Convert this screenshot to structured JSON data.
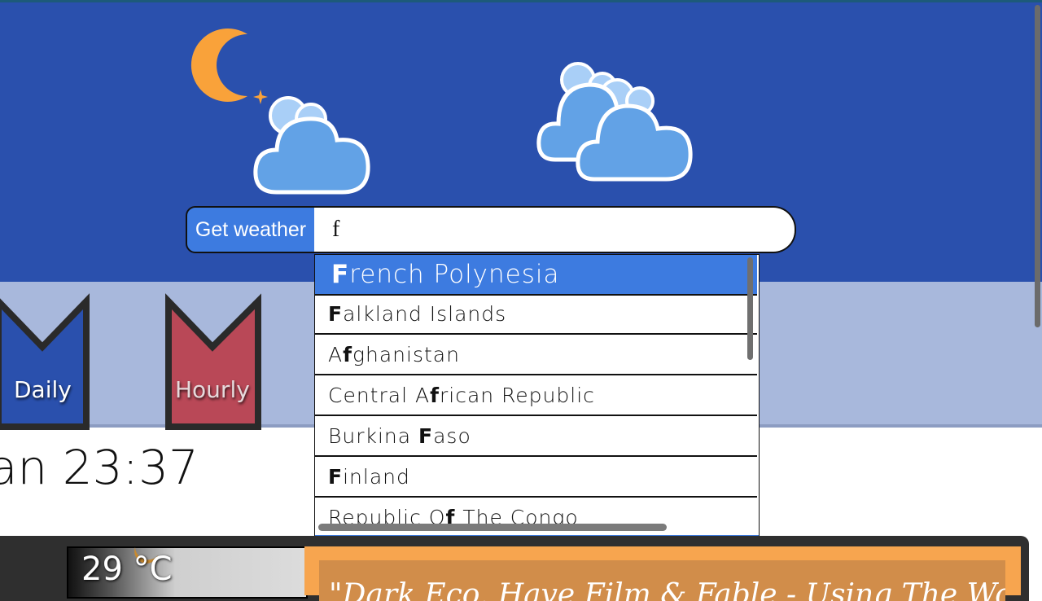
{
  "app": {
    "get_weather_label": "Get weather",
    "search_value": "f"
  },
  "suggestions": [
    {
      "before": "",
      "match": "F",
      "after": "rench Polynesia",
      "active": true
    },
    {
      "before": "",
      "match": "F",
      "after": "alkland Islands",
      "active": false
    },
    {
      "before": "A",
      "match": "f",
      "after": "ghanistan",
      "active": false
    },
    {
      "before": "Central A",
      "match": "f",
      "after": "rican Republic",
      "active": false
    },
    {
      "before": "Burkina ",
      "match": "F",
      "after": "aso",
      "active": false
    },
    {
      "before": "",
      "match": "F",
      "after": "inland",
      "active": false
    },
    {
      "before": "Republic O",
      "match": "f",
      "after": " The Congo",
      "active": false
    }
  ],
  "tabs": {
    "daily": "Daily",
    "hourly": "Hourly"
  },
  "time_text": "an 23:37",
  "current": {
    "temperature": "29 °C",
    "description": "\"Dark Eco. Have Film & Fable - Using The Word \"Fiend\" -\""
  },
  "colors": {
    "hero": "#2a50ad",
    "band": "#a8b8dc",
    "accent_blue": "#3d7be0",
    "moon": "#f9a23a",
    "cloud": "#62a2e6",
    "daily_tab": "#2a50ad",
    "hourly_tab": "#b94857",
    "temp_card": "#dcdcdc",
    "desc_card": "#f7a54f"
  },
  "icons": [
    "moon-icon",
    "star-icon",
    "cloud-icon",
    "clouds-icon"
  ]
}
